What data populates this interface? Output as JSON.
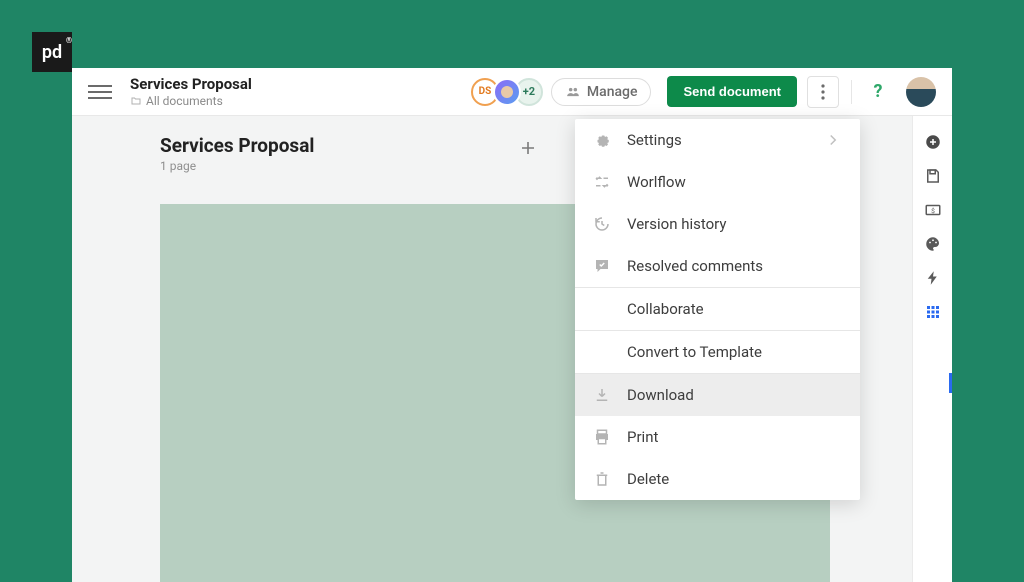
{
  "logo": "pd",
  "topbar": {
    "title": "Services Proposal",
    "breadcrumb": "All documents",
    "avatars": {
      "initials": "DS",
      "more": "+2"
    },
    "manage_label": "Manage",
    "send_label": "Send document"
  },
  "canvas": {
    "title": "Services Proposal",
    "page_count": "1 page"
  },
  "menu": {
    "settings": "Settings",
    "workflow": "Worlflow",
    "version": "Version history",
    "resolved": "Resolved comments",
    "collaborate": "Collaborate",
    "convert": "Convert to Template",
    "download": "Download",
    "print": "Print",
    "delete": "Delete"
  }
}
